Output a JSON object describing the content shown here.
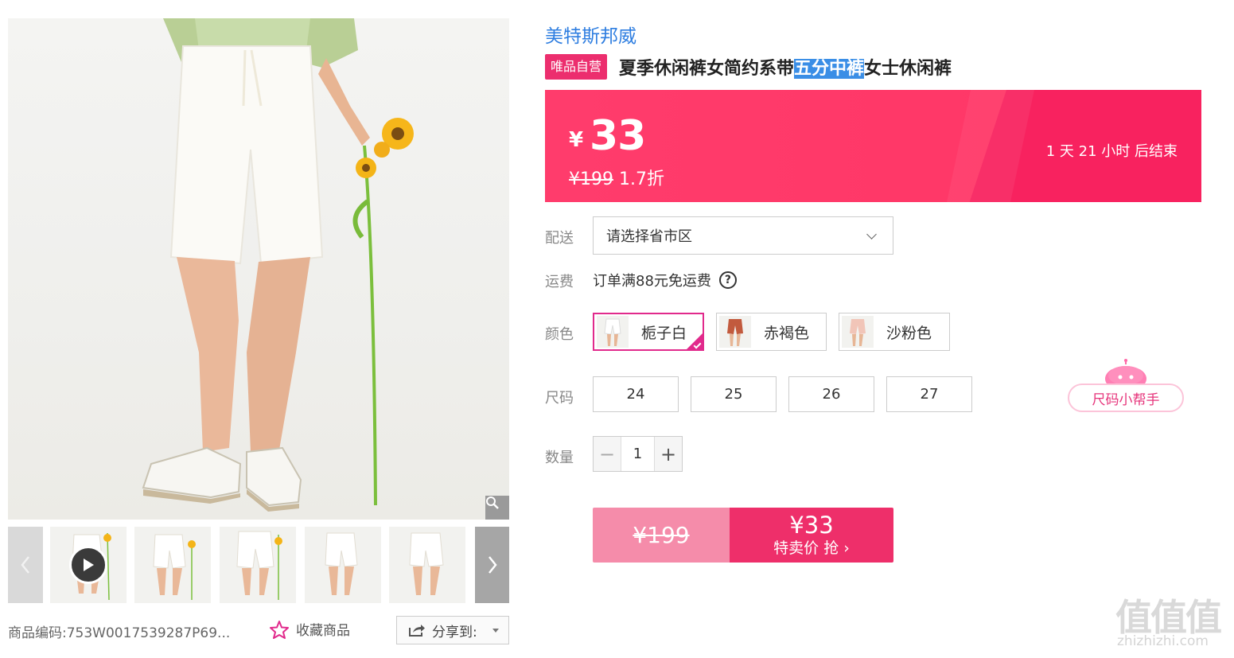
{
  "gallery": {
    "thumbs_count": 5,
    "sku_label": "商品编码:",
    "sku_value": "753W0017539287P69...",
    "favorite_label": "收藏商品",
    "share_label": "分享到:"
  },
  "product": {
    "brand": "美特斯邦威",
    "badge": "唯品自营",
    "title_before": "夏季休闲裤女简约系带",
    "title_highlight": "五分中裤",
    "title_after": "女士休闲裤"
  },
  "price": {
    "currency": "¥",
    "current": "33",
    "original": "¥199",
    "discount": "1.7折",
    "countdown": "1 天 21 小时 后结束"
  },
  "delivery": {
    "label": "配送",
    "placeholder": "请选择省市区"
  },
  "shipping": {
    "label": "运费",
    "text": "订单满88元免运费",
    "help": "?"
  },
  "colors": {
    "label": "颜色",
    "options": [
      {
        "name": "栀子白",
        "selected": true,
        "swatch": "#f3f1ec"
      },
      {
        "name": "赤褐色",
        "selected": false,
        "swatch": "#c25a3d"
      },
      {
        "name": "沙粉色",
        "selected": false,
        "swatch": "#f1c5b8"
      }
    ]
  },
  "sizes": {
    "label": "尺码",
    "options": [
      "24",
      "25",
      "26",
      "27"
    ],
    "helper": "尺码小帮手"
  },
  "quantity": {
    "label": "数量",
    "value": "1",
    "minus": "−",
    "plus": "+"
  },
  "buy": {
    "original": "¥199",
    "price": "¥33",
    "cta": "特卖价 抢 ›"
  },
  "watermark": {
    "title": "值值值",
    "url": "zhizhizhi.com"
  },
  "colors_theme": {
    "accent": "#f8225f",
    "brand_link": "#2d7de0",
    "selected_border": "#e12a8c"
  }
}
